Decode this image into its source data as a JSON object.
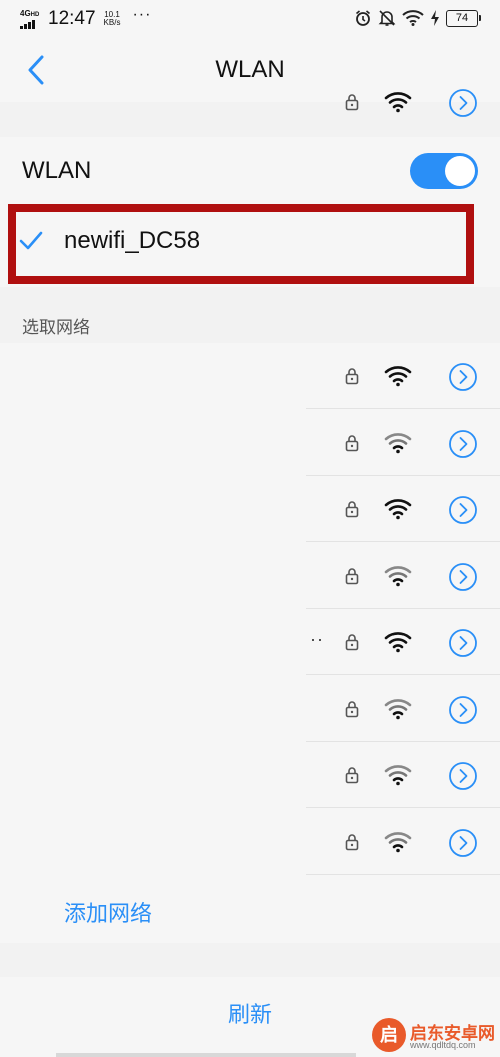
{
  "status_bar": {
    "network": "4G",
    "network_suffix": "HD",
    "time": "12:47",
    "speed_value": "10.1",
    "speed_unit": "KB/s",
    "overflow": "···",
    "battery": "74",
    "icons": [
      "alarm-icon",
      "mute-icon",
      "wifi-icon",
      "charging-icon"
    ]
  },
  "header": {
    "title": "WLAN",
    "back_icon": "chevron-left-icon"
  },
  "wlan": {
    "label": "WLAN",
    "enabled": true
  },
  "connected": {
    "ssid": "newifi_DC58",
    "secured": true,
    "signal": "strong"
  },
  "available": {
    "section_label": "选取网络",
    "networks": [
      {
        "name": "",
        "secured": true,
        "signal": "strong"
      },
      {
        "name": "",
        "secured": true,
        "signal": "medium"
      },
      {
        "name": "",
        "secured": true,
        "signal": "strong"
      },
      {
        "name": "",
        "secured": true,
        "signal": "medium"
      },
      {
        "name": "··",
        "secured": true,
        "signal": "strong"
      },
      {
        "name": "",
        "secured": true,
        "signal": "medium"
      },
      {
        "name": "",
        "secured": true,
        "signal": "medium"
      },
      {
        "name": "",
        "secured": true,
        "signal": "medium"
      }
    ]
  },
  "add_network_label": "添加网络",
  "refresh_label": "刷新",
  "watermark": {
    "logo": "启",
    "title": "启东安卓网",
    "url": "www.qdltdq.com"
  },
  "colors": {
    "accent": "#2a8ff7",
    "highlight_border": "#b01010",
    "background": "#f2f2f2"
  }
}
